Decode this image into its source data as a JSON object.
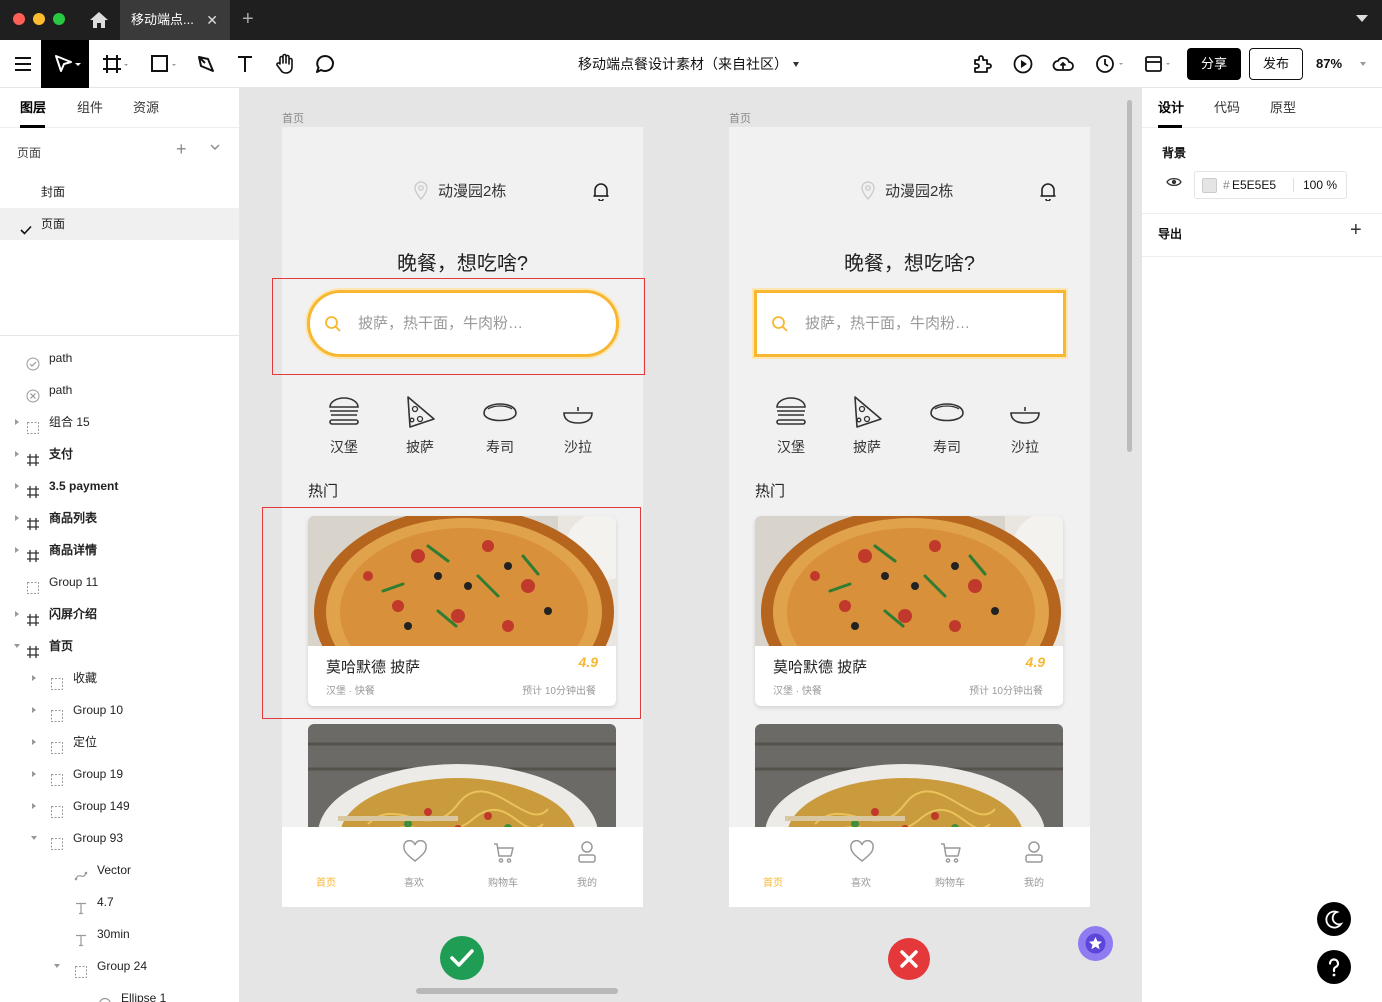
{
  "titlebar": {
    "tab_title": "移动端点...",
    "tab_close": "✕",
    "tab_add": "+"
  },
  "toolbar": {
    "doc_title": "移动端点餐设计素材（来自社区）",
    "share_label": "分享",
    "publish_label": "发布",
    "zoom_label": "87%"
  },
  "left_panel": {
    "tabs": [
      "图层",
      "组件",
      "资源"
    ],
    "pages_label": "页面",
    "pages": [
      "封面",
      "页面"
    ],
    "layers": [
      "path",
      "path",
      "组合 15",
      "支付",
      "3.5 payment",
      "商品列表",
      "商品详情",
      "Group 11",
      "闪屏介绍",
      "首页",
      "收藏",
      "Group 10",
      "定位",
      "Group 19",
      "Group 149",
      "Group 93",
      "Vector",
      "4.7",
      "30min",
      "Group 24",
      "Ellipse 1"
    ]
  },
  "phone_left": {
    "frame_label": "首页",
    "location": "动漫园2栋",
    "headline": "晚餐，想吃啥?",
    "search_placeholder": "披萨，热干面，牛肉粉…",
    "categories": [
      "汉堡",
      "披萨",
      "寿司",
      "沙拉"
    ],
    "hot_label": "热门",
    "card": {
      "name": "莫哈默德 披萨",
      "rating": "4.9",
      "meta": "汉堡 · 快餐",
      "eta": "预计 10分钟出餐"
    },
    "tabs": [
      "首页",
      "喜欢",
      "购物车",
      "我的"
    ]
  },
  "phone_right": {
    "frame_label": "首页",
    "location": "动漫园2栋",
    "headline": "晚餐，想吃啥?",
    "search_placeholder": "披萨，热干面，牛肉粉…",
    "categories": [
      "汉堡",
      "披萨",
      "寿司",
      "沙拉"
    ],
    "hot_label": "热门",
    "card": {
      "name": "莫哈默德 披萨",
      "rating": "4.9",
      "meta": "汉堡 · 快餐",
      "eta": "预计 10分钟出餐"
    },
    "tabs": [
      "首页",
      "喜欢",
      "购物车",
      "我的"
    ]
  },
  "right_panel": {
    "tabs": [
      "设计",
      "代码",
      "原型"
    ],
    "background_label": "背景",
    "bg_hash": "#",
    "bg_hex": "E5E5E5",
    "bg_opacity": "100 %",
    "export_label": "导出",
    "export_add": "+"
  },
  "colors": {
    "accent": "#f7b731",
    "canvas": "#e5e5e5",
    "ok": "#1f9d55",
    "bad": "#e5383b",
    "annotation": "#e23a3a"
  }
}
